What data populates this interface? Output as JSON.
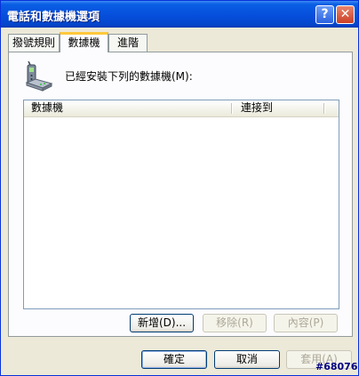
{
  "window": {
    "title": "電話和數據機選項"
  },
  "titlebar_buttons": {
    "help": "?",
    "close": "✕"
  },
  "tabs": [
    {
      "label": "撥號規則"
    },
    {
      "label": "數據機"
    },
    {
      "label": "進階"
    }
  ],
  "modems_page": {
    "icon": "modem-phone-icon",
    "installed_label": "已經安裝下列的數據機(M):",
    "columns": [
      "數據機",
      "連接到"
    ],
    "rows": [],
    "buttons": {
      "add": "新增(D)...",
      "remove": "移除(R)",
      "properties": "內容(P)"
    }
  },
  "dialog_buttons": {
    "ok": "確定",
    "cancel": "取消",
    "apply": "套用(A)"
  },
  "watermark": "#68076",
  "colors": {
    "titlebar": "#0650dd",
    "face": "#ece9d8",
    "active_tab_highlight": "#ffc83c"
  }
}
